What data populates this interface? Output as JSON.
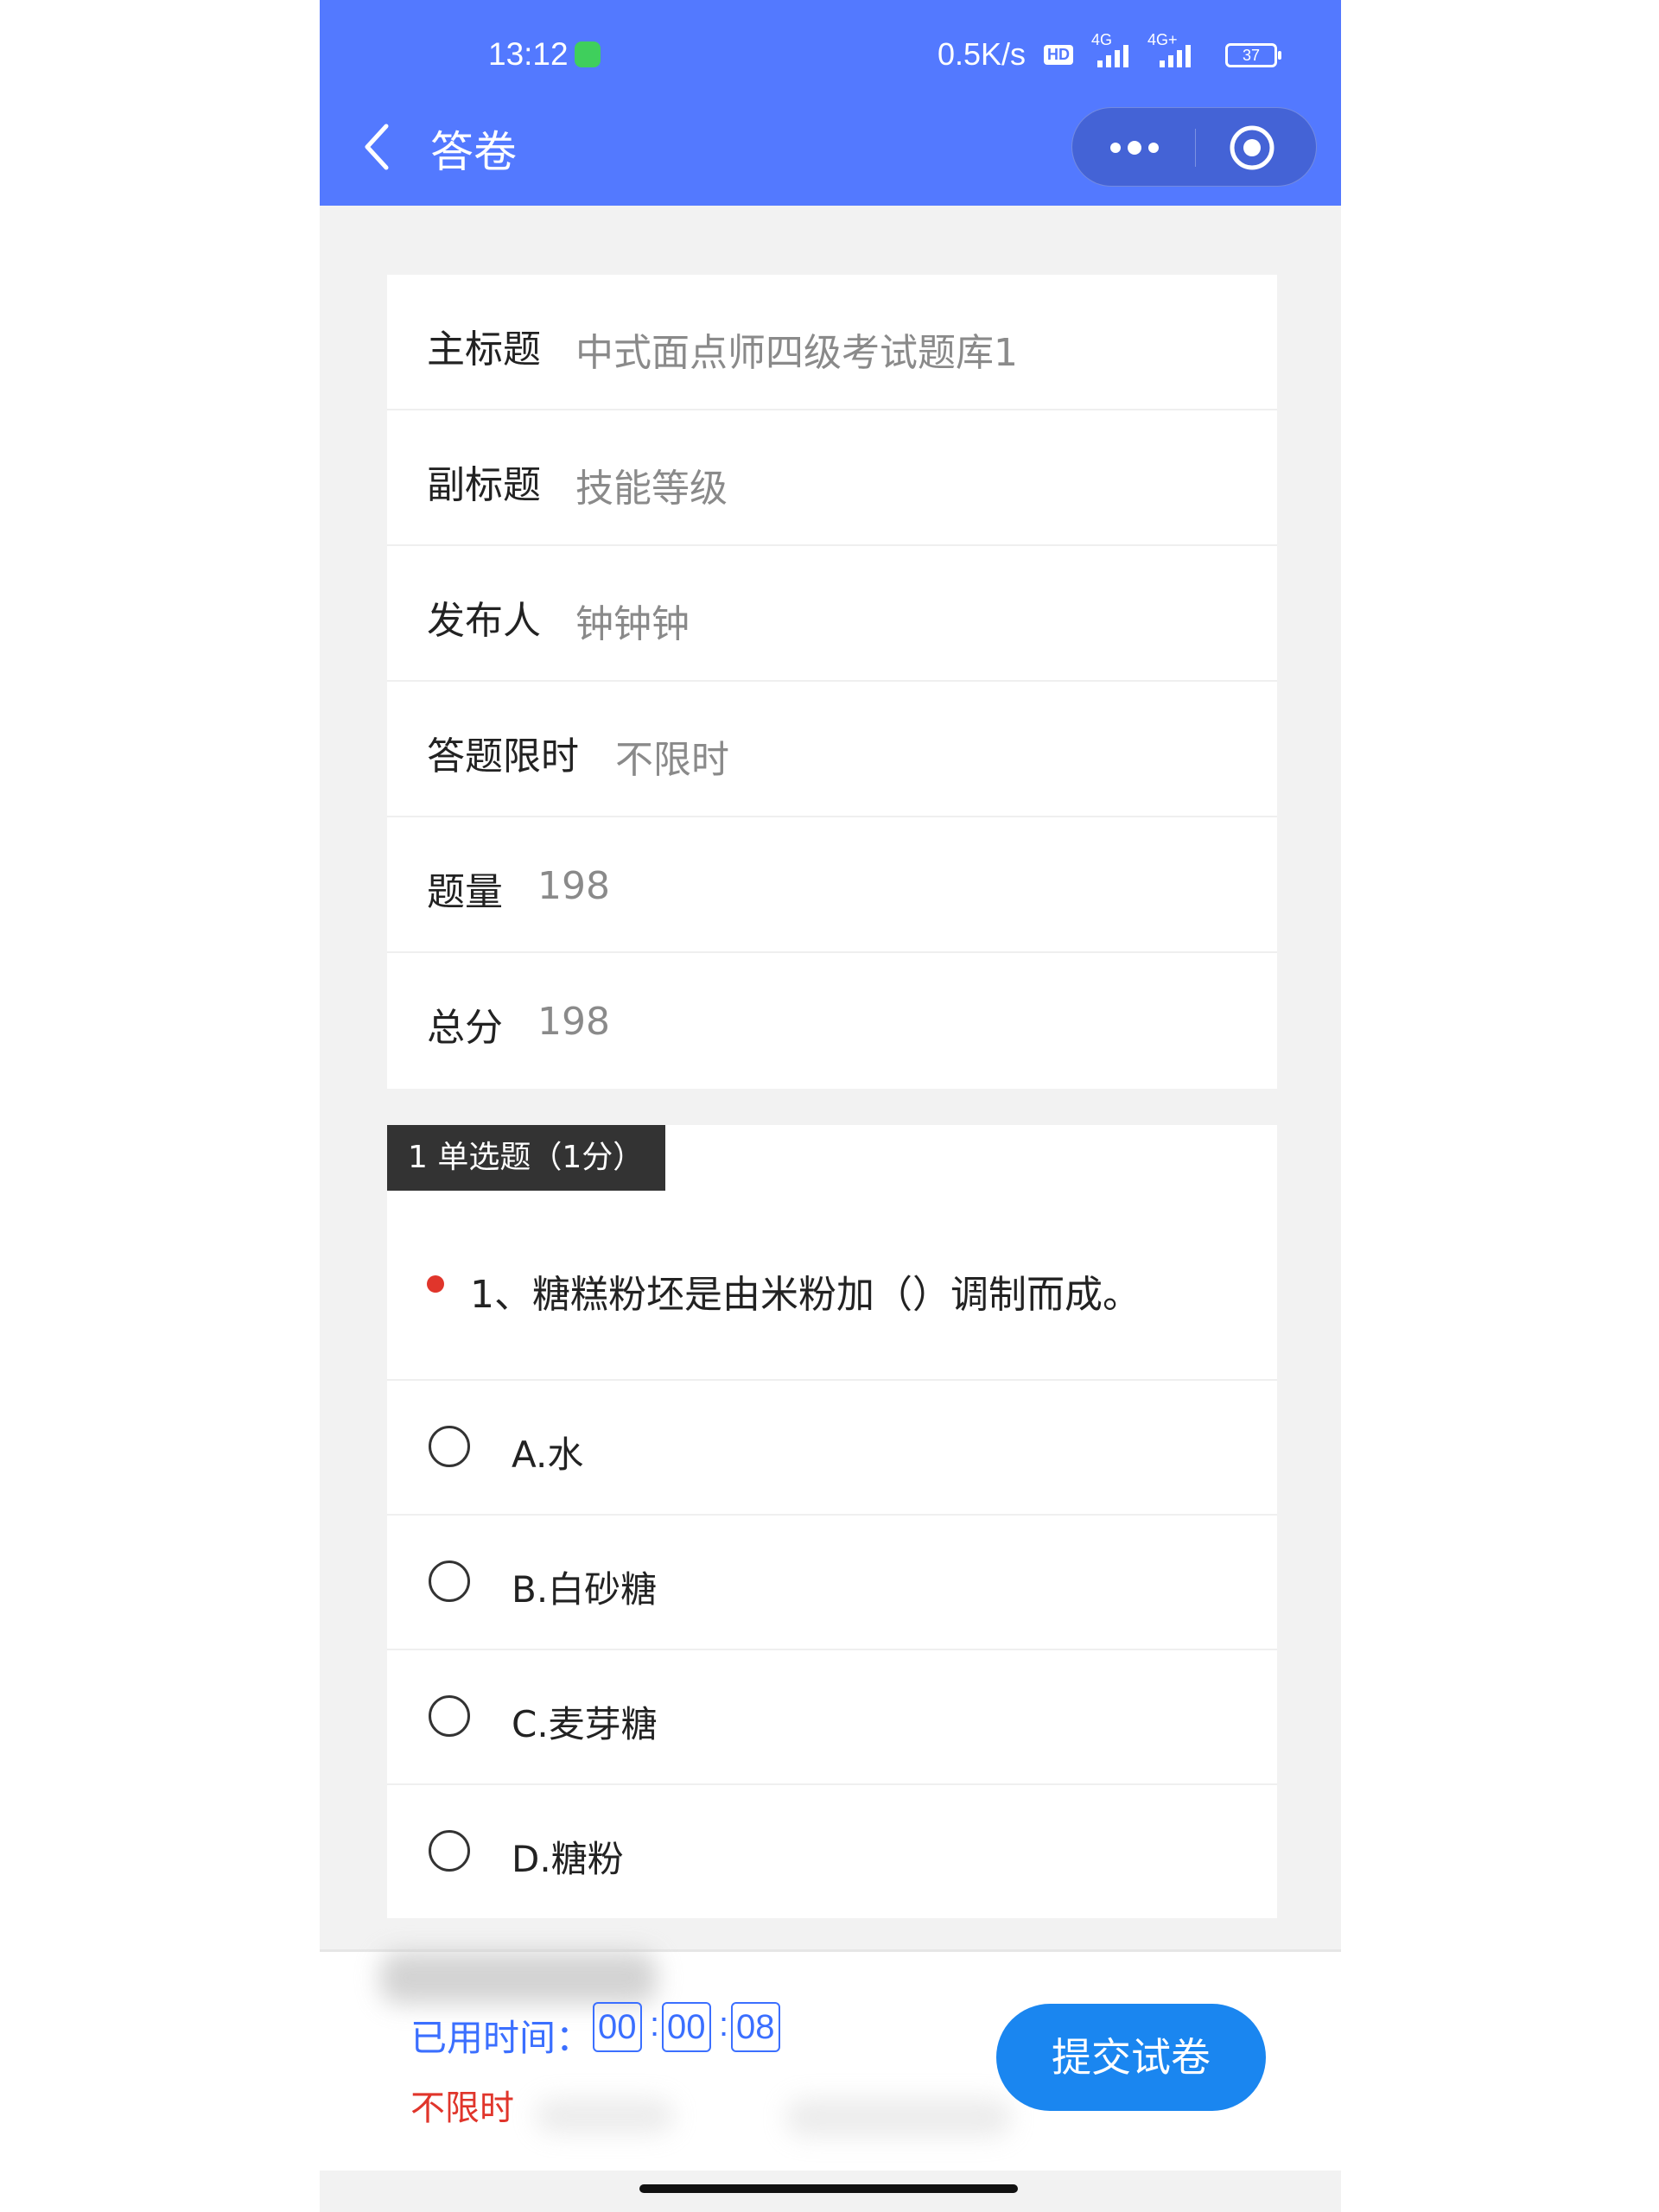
{
  "status_bar": {
    "time": "13:12",
    "net_speed": "0.5K/s",
    "hd_badge": "HD",
    "net_type_1": "4G",
    "net_type_2": "4G+",
    "battery": "37"
  },
  "nav": {
    "title": "答卷"
  },
  "info": {
    "rows": [
      {
        "label": "主标题",
        "value": "中式面点师四级考试题库1"
      },
      {
        "label": "副标题",
        "value": "技能等级"
      },
      {
        "label": "发布人",
        "value": "钟钟钟"
      },
      {
        "label": "答题限时",
        "value": "不限时"
      },
      {
        "label": "题量",
        "value": "198"
      },
      {
        "label": "总分",
        "value": "198"
      }
    ]
  },
  "question": {
    "header": "1 单选题（1分）",
    "text": "1、糖糕粉坯是由米粉加（）调制而成。",
    "options": [
      {
        "label": "A.水"
      },
      {
        "label": "B.白砂糖"
      },
      {
        "label": "C.麦芽糖"
      },
      {
        "label": "D.糖粉"
      }
    ]
  },
  "footer": {
    "elapsed_label": "已用时间：",
    "hours": "00",
    "minutes": "00",
    "seconds": "08",
    "separator": ":",
    "limit_text": "不限时",
    "submit_label": "提交试卷"
  },
  "colors": {
    "primary": "#5379ff",
    "accent_blue": "#1a86f0",
    "timer_blue": "#3b6fff",
    "alert_red": "#e0352b",
    "header_dark": "#333333"
  }
}
